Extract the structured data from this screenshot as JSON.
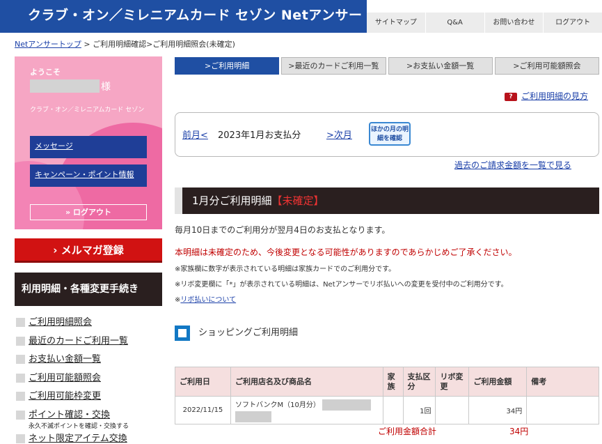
{
  "header": {
    "brand": "クラブ・オン／ミレニアムカード セゾン  Netアンサー",
    "nav": [
      "サイトマップ",
      "Q&A",
      "お問い合わせ",
      "ログアウト"
    ]
  },
  "breadcrumb": {
    "home": "Netアンサートップ",
    "trail": " > ご利用明細確認>ご利用明細照会(未確定)"
  },
  "sidebar": {
    "welcome": "ようこそ",
    "honorific": "様",
    "card_name": "クラブ・オン／ミレニアムカード セゾン",
    "message_btn": "メッセージ",
    "campaign_btn": "キャンペーン・ポイント情報",
    "logout_btn": "ログアウト",
    "mailmag": "メルマガ登録",
    "procedures_title": "利用明細・各種変更手続き",
    "menu": [
      {
        "label": "ご利用明細照会"
      },
      {
        "label": "最近のカードご利用一覧"
      },
      {
        "label": "お支払い金額一覧"
      },
      {
        "label": "ご利用可能額照会"
      },
      {
        "label": "ご利用可能枠変更"
      },
      {
        "label": "ポイント確認・交換",
        "sub": "永久不滅ポイントを確認・交換する"
      },
      {
        "label": "ネット限定アイテム交換"
      }
    ]
  },
  "main": {
    "tabs": [
      "ご利用明細",
      "最近のカードご利用一覧",
      "お支払い金額一覧",
      "ご利用可能額照会"
    ],
    "howto": "ご利用明細の見方",
    "month": {
      "prev": "前月<",
      "current": "2023年1月お支払分",
      "next": ">次月",
      "other": "ほかの月の明細を確認"
    },
    "past_link": "過去のご請求金額を一覧で見る",
    "statement_title": "1月分ご利用明細",
    "statement_status": "【未確定】",
    "notice1": "毎月10日までのご利用分が翌月4日のお支払となります。",
    "notice2": "本明細は未確定のため、今後変更となる可能性がありますのであらかじめご了承ください。",
    "notice3": "※家族欄に数字が表示されている明細は家族カードでのご利用分です。",
    "notice4": "※リボ変更欄に「*」が表示されている明細は、Netアンサーでリボ払いへの変更を受付中のご利用分です。",
    "notice5_prefix": "※",
    "notice5_link": "リボ払いについて",
    "shopping_title": "ショッピングご利用明細",
    "table": {
      "headers": [
        "ご利用日",
        "ご利用店名及び商品名",
        "家族",
        "支払区分",
        "リボ変更",
        "ご利用金額",
        "備考"
      ],
      "rows": [
        {
          "date": "2022/11/15",
          "store": "ソフトバンクM（10月分）",
          "family": "",
          "payment": "1回",
          "revo": "",
          "amount": "34円",
          "note": ""
        }
      ]
    },
    "total_label": "ご利用金額合計",
    "total_value": "34円"
  }
}
